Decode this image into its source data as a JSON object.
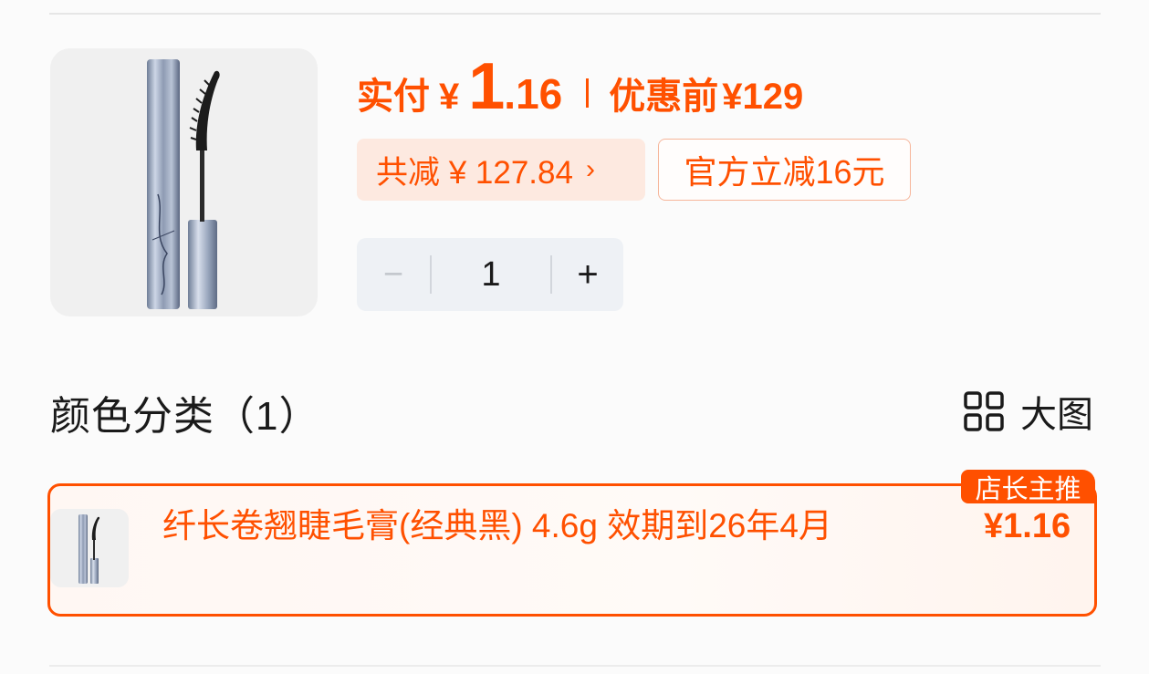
{
  "price": {
    "pay_label": "实付",
    "currency": "¥",
    "pay_int": "1",
    "pay_dec": ".16",
    "orig_label": "优惠前",
    "orig_price": "¥129",
    "accent_color": "#ff5000"
  },
  "discounts": {
    "total_reduction": "共减 ¥ 127.84",
    "chevron": "›",
    "official": "官方立减16元"
  },
  "quantity": {
    "minus": "−",
    "value": "1",
    "plus": "+"
  },
  "section": {
    "title": "颜色分类（1）",
    "toggle_icon": "grid-icon",
    "toggle_label": "大图"
  },
  "options": [
    {
      "name": "纤长卷翘睫毛膏(经典黑) 4.6g 效期到26年4月",
      "price": "¥1.16",
      "badge": "店长主推",
      "selected": true
    }
  ],
  "icons": {
    "product": "mascara-image",
    "option": "mascara-thumbnail"
  }
}
